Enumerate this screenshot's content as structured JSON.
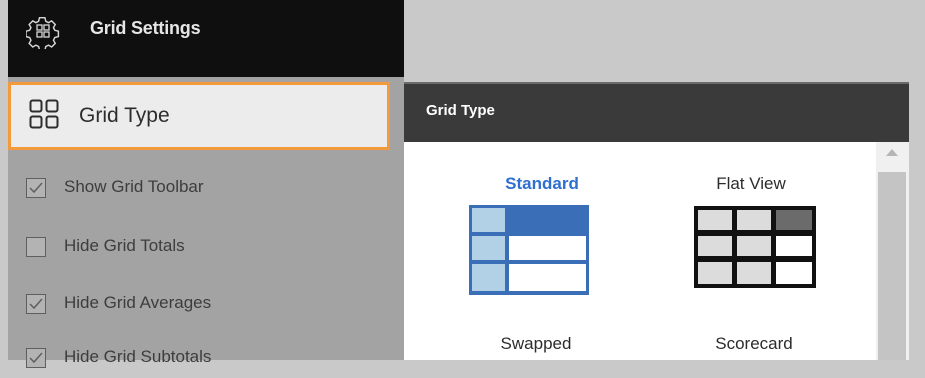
{
  "sidebar": {
    "header_title": "Grid Settings",
    "header_icon": "grid-settings-gear-icon",
    "grid_type_item": {
      "label": "Grid Type",
      "icon": "four-squares-icon"
    },
    "options": [
      {
        "label": "Show Grid Toolbar",
        "checked": true
      },
      {
        "label": "Hide Grid Totals",
        "checked": false
      },
      {
        "label": "Hide Grid Averages",
        "checked": true
      },
      {
        "label": "Hide Grid Subtotals",
        "checked": true
      }
    ]
  },
  "popup": {
    "title": "Grid Type",
    "grid_types": [
      {
        "label": "Standard",
        "selected": true
      },
      {
        "label": "Flat View",
        "selected": false
      },
      {
        "label": "Swapped",
        "selected": false
      },
      {
        "label": "Scorecard",
        "selected": false
      }
    ]
  },
  "colors": {
    "highlight_border": "#f39a3c",
    "selected_text": "#2f6fd0",
    "standard_blue": "#3a6fb7",
    "standard_light": "#b3d1e6",
    "popup_header": "#3a3a3a",
    "sidebar_header": "#0f0f0f"
  }
}
